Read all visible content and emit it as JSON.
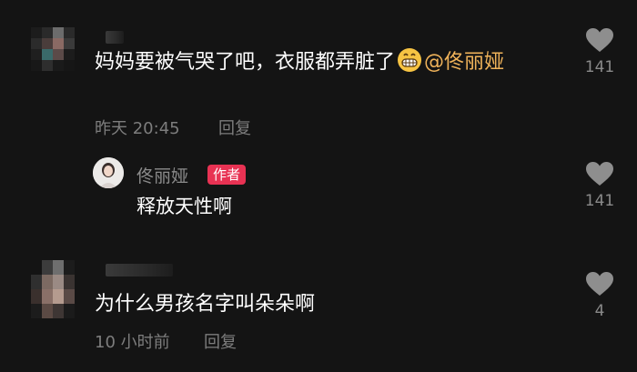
{
  "comments": [
    {
      "text_prefix": "妈妈要被气哭了吧，衣服都弄脏了",
      "emoji_name": "grinning-face-emoji",
      "mention": "@佟丽娅",
      "time": "昨天 20:45",
      "reply_label": "回复",
      "likes": "141"
    },
    {
      "text": "为什么男孩名字叫朵朵啊",
      "time": "10 小时前",
      "reply_label": "回复",
      "likes": "4"
    }
  ],
  "author_reply": {
    "name": "佟丽娅",
    "badge": "作者",
    "text": "释放天性啊",
    "likes": "141"
  },
  "icons": {
    "like": "heart-icon",
    "emoji": "grinning-face-emoji"
  },
  "colors": {
    "background": "#141414",
    "mention": "#f0b35a",
    "badge": "#e83253",
    "meta": "#7d7d7d",
    "heart": "#8e8e8e"
  }
}
